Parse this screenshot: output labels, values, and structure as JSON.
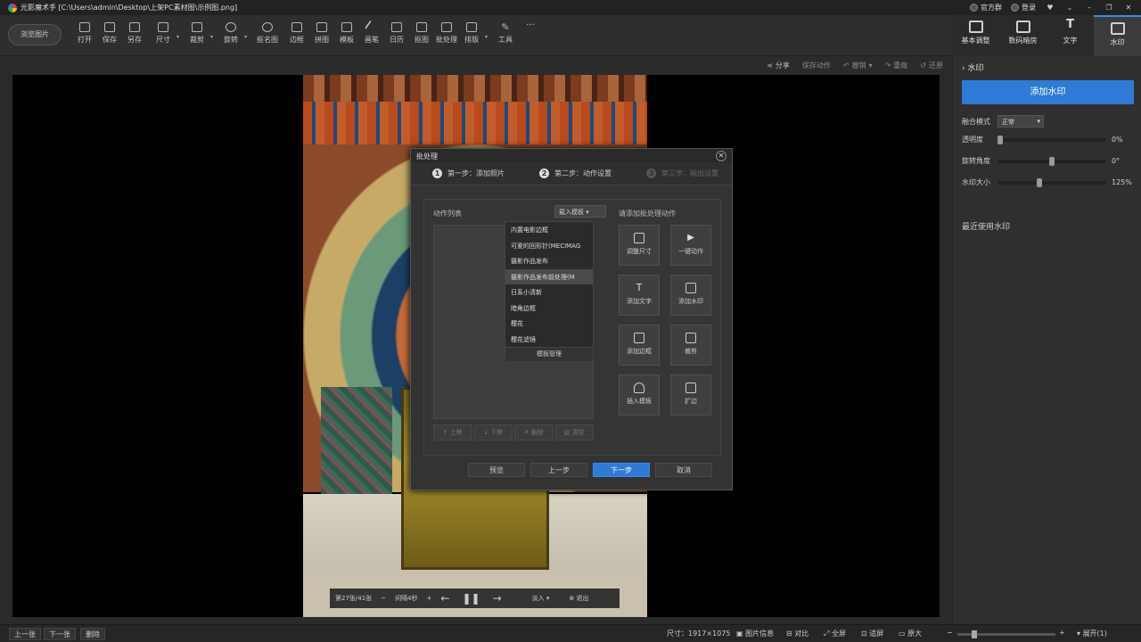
{
  "titlebar": {
    "title": "光影魔术手 [C:\\Users\\admin\\Desktop\\上架PC素材图\\示例图.png]",
    "links": [
      "官方群",
      "登录"
    ]
  },
  "toolbar": {
    "browse_label": "浏览图片",
    "tools": [
      "打开",
      "保存",
      "另存",
      "尺寸",
      "裁剪",
      "旋转",
      "抠名图",
      "边框",
      "拼图",
      "模板",
      "画笔",
      "日历",
      "抠图",
      "批处理",
      "排版",
      "工具"
    ]
  },
  "right_tabs": [
    "基本调整",
    "数码暗房",
    "文字",
    "水印"
  ],
  "subbar": [
    "分享",
    "保存动作",
    "撤销",
    "重做",
    "还原"
  ],
  "dialog": {
    "title": "批处理",
    "steps": [
      {
        "num": "1",
        "label": "第一步：添加照片"
      },
      {
        "num": "2",
        "label": "第二步：动作设置"
      },
      {
        "num": "3",
        "label": "第三步：输出设置"
      }
    ],
    "action_list_label": "动作列表",
    "load_template": "载入模板",
    "template_items": [
      "内置电影边框",
      "可爱的回形针(MECIMAG",
      "摄影作品发布",
      "摄影作品发布前处理(M",
      "日系小清新",
      "暗角边框",
      "樱花",
      "樱花滤镜"
    ],
    "template_selected_index": 3,
    "template_manage": "模板管理",
    "list_buttons": [
      "上移",
      "下移",
      "删除",
      "清空"
    ],
    "add_actions_label": "请添加批处理动作",
    "actions": [
      "调整尺寸",
      "一键动作",
      "添加文字",
      "添加水印",
      "添加边框",
      "裁剪",
      "插入模板",
      "扩边"
    ],
    "footer_buttons": [
      "预览",
      "上一步",
      "下一步",
      "取消"
    ]
  },
  "playbar": {
    "position": "第27张/41张",
    "interval": "间隔4秒",
    "mode": "淡入",
    "exit": "退出"
  },
  "right_panel": {
    "section": "水印",
    "add_button": "添加水印",
    "blend_label": "融合模式",
    "blend_value": "正常",
    "opacity_label": "透明度",
    "opacity_value": "0%",
    "rotation_label": "旋转角度",
    "rotation_value": "0°",
    "size_label": "水印大小",
    "size_value": "125%",
    "recent_label": "最近使用水印"
  },
  "status": {
    "prev": "上一张",
    "next": "下一张",
    "delete": "删除",
    "size": "尺寸：1917×1075",
    "info": "图片信息",
    "compare": "对比",
    "fullscreen": "全屏",
    "fit": "适屏",
    "actual": "原大",
    "expand": "展开(1)"
  }
}
